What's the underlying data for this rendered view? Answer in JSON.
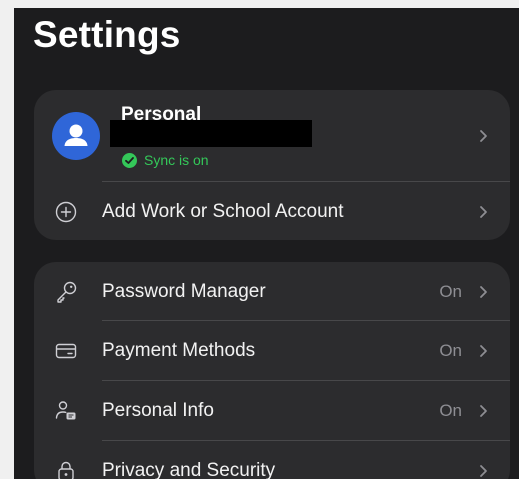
{
  "header": {
    "title": "Settings"
  },
  "profile": {
    "name": "Personal",
    "sync_status": "Sync is on",
    "accent_color": "#2f66d8",
    "sync_color": "#34c759"
  },
  "add_account": {
    "label": "Add Work or School Account"
  },
  "settings_list": {
    "password_manager": {
      "label": "Password Manager",
      "status": "On",
      "icon": "key-icon"
    },
    "payment_methods": {
      "label": "Payment Methods",
      "status": "On",
      "icon": "card-icon"
    },
    "personal_info": {
      "label": "Personal Info",
      "status": "On",
      "icon": "person-card-icon"
    },
    "privacy_security": {
      "label": "Privacy and Security",
      "icon": "lock-icon"
    }
  }
}
